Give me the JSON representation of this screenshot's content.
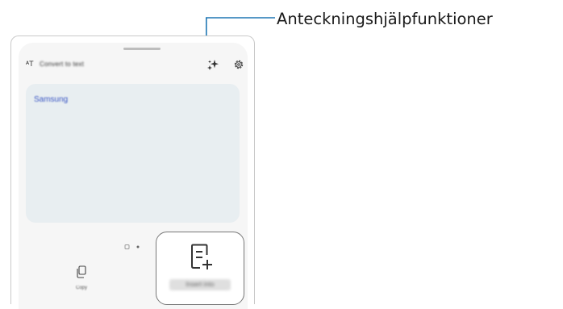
{
  "callout": {
    "label": "Anteckningshjälpfunktioner",
    "line_color": "#1f77b4"
  },
  "panel": {
    "header_label": "Convert to text",
    "header_icon": "text-convert-icon",
    "sparkle_icon": "note-assist-sparkle-icon",
    "settings_icon": "gear-icon",
    "text_content": "Samsung",
    "text_color": "#3b57c4",
    "page_indicator_icons": [
      "page-grid-icon",
      "page-dot-icon"
    ]
  },
  "bottom_bar": {
    "left_icon": "copy-icon",
    "left_label": "Copy",
    "right_icon": "note-add-icon",
    "right_label": "Insert into"
  }
}
